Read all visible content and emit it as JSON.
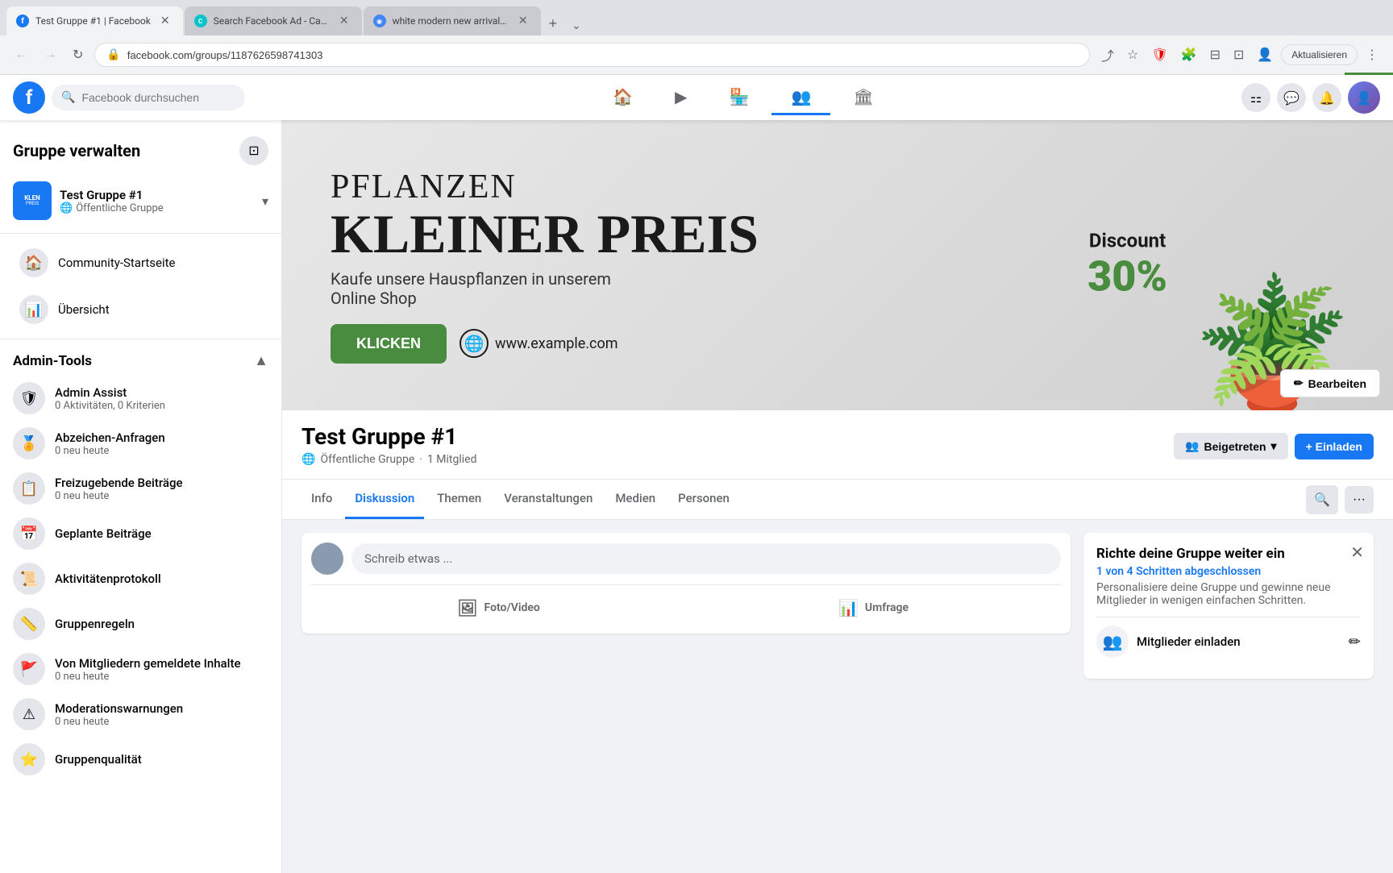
{
  "browser": {
    "tabs": [
      {
        "id": "tab1",
        "label": "Test Gruppe #1 | Facebook",
        "favicon": "fb",
        "active": true
      },
      {
        "id": "tab2",
        "label": "Search Facebook Ad - Canva",
        "favicon": "canva",
        "active": false
      },
      {
        "id": "tab3",
        "label": "white modern new arrival watc...",
        "favicon": "other",
        "active": false
      }
    ],
    "url": "facebook.com/groups/11876265987413​03",
    "aktualisieren": "Aktualisieren"
  },
  "header": {
    "search_placeholder": "Facebook durchsuchen",
    "nav_items": [
      "🏠",
      "▶",
      "🏪",
      "👥",
      "🏛"
    ]
  },
  "sidebar": {
    "title": "Gruppe verwalten",
    "group": {
      "name": "Test Gruppe #1",
      "type": "Öffentliche Gruppe"
    },
    "nav": [
      {
        "icon": "🏠",
        "label": "Community-Startseite"
      },
      {
        "icon": "📊",
        "label": "Übersicht"
      }
    ],
    "admin_section": "Admin-Tools",
    "admin_items": [
      {
        "icon": "🛡",
        "label": "Admin Assist",
        "sub": "0 Aktivitäten, 0 Kriterien"
      },
      {
        "icon": "🏅",
        "label": "Abzeichen-Anfragen",
        "sub": "0 neu heute"
      },
      {
        "icon": "📋",
        "label": "Freizugebende Beiträge",
        "sub": "0 neu heute"
      },
      {
        "icon": "📅",
        "label": "Geplante Beiträge",
        "sub": ""
      },
      {
        "icon": "📜",
        "label": "Aktivitätenprotokoll",
        "sub": ""
      },
      {
        "icon": "📏",
        "label": "Gruppenregeln",
        "sub": ""
      },
      {
        "icon": "🚩",
        "label": "Von Mitgliedern gemeldete Inhalte",
        "sub": "0 neu heute"
      },
      {
        "icon": "⚠",
        "label": "Moderationswarnungen",
        "sub": "0 neu heute"
      },
      {
        "icon": "⭐",
        "label": "Gruppenqualität",
        "sub": ""
      }
    ]
  },
  "cover": {
    "title_top": "PFLANZEN",
    "title_main": "KLEINER PREIS",
    "subtitle1": "Kaufe unsere Hauspflanzen in unserem",
    "subtitle2": "Online Shop",
    "btn_label": "KLICKEN",
    "website": "www.example.com",
    "discount_label": "Discount",
    "discount_value": "30%",
    "edit_btn": "Bearbeiten"
  },
  "group": {
    "name": "Test Gruppe #1",
    "type": "Öffentliche Gruppe",
    "members": "1 Mitglied",
    "btn_joined": "Beigetreten",
    "btn_invite": "+ Einladen"
  },
  "tabs": {
    "items": [
      "Info",
      "Diskussion",
      "Themen",
      "Veranstaltungen",
      "Medien",
      "Personen"
    ],
    "active": "Diskussion"
  },
  "post": {
    "placeholder": "Schreib etwas ...",
    "actions": [
      {
        "icon": "🖼",
        "label": "Foto/Video"
      },
      {
        "icon": "📊",
        "label": "Umfrage"
      }
    ]
  },
  "setup_panel": {
    "title": "Richte deine Gruppe weiter ein",
    "progress": "1 von 4 Schritten abgeschlossen",
    "description": "Personalisiere deine Gruppe und gewinne neue Mitglieder in wenigen einfachen Schritten.",
    "items": [
      {
        "icon": "👥",
        "label": "Mitglieder einladen"
      }
    ]
  }
}
